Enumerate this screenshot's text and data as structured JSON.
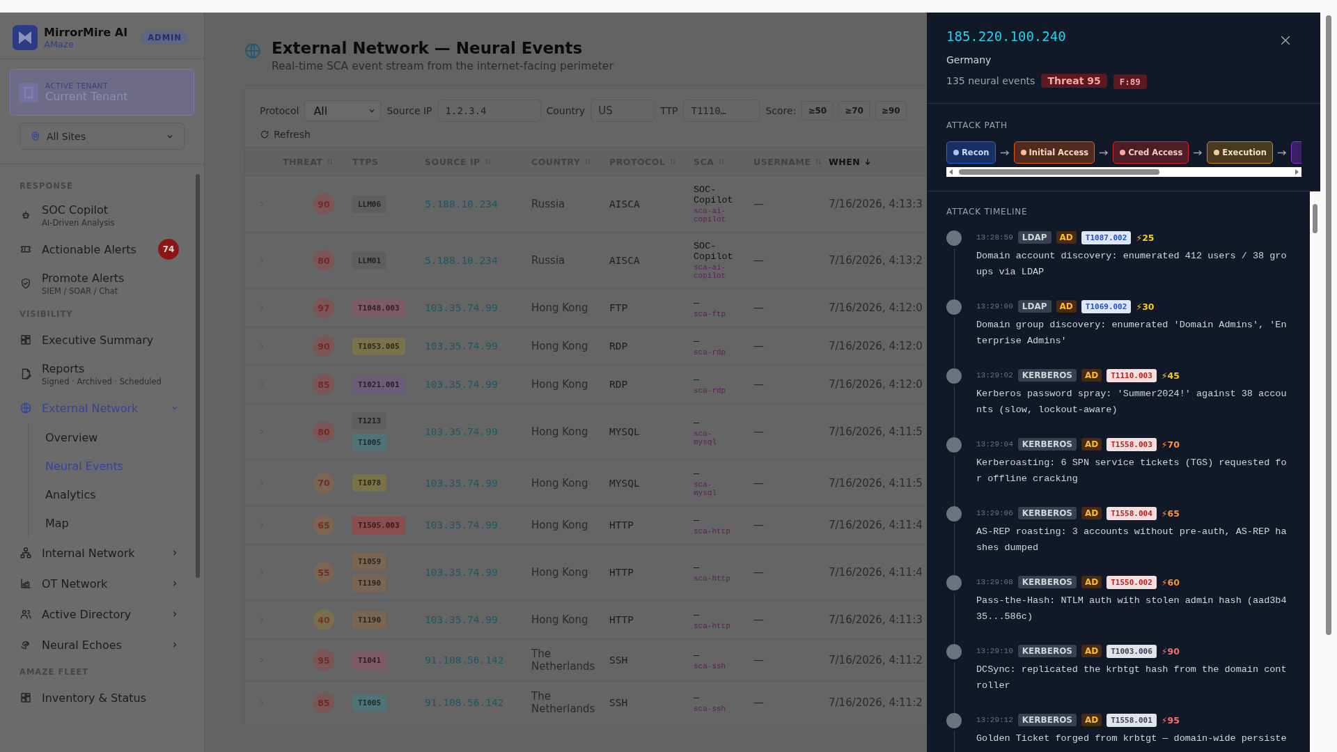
{
  "sidebar": {
    "brand": {
      "name": "MirrorMire AI",
      "org": "AMaze",
      "role": "ADMIN"
    },
    "tenant": {
      "label": "ACTIVE TENANT",
      "name": "Current Tenant"
    },
    "site_select": {
      "value": "All Sites"
    },
    "sections": [
      {
        "title": "RESPONSE",
        "items": [
          {
            "label": "SOC Copilot",
            "sublabel": "AI-Driven Analysis",
            "selected": false
          },
          {
            "label": "Actionable Alerts",
            "badge": "74",
            "selected": false
          },
          {
            "label": "Promote Alerts",
            "sublabel": "SIEM / SOAR / Chat",
            "selected": false
          }
        ]
      },
      {
        "title": "VISIBILITY",
        "items": [
          {
            "label": "Executive Summary",
            "selected": false
          },
          {
            "label": "Reports",
            "sublabel": "Signed · Archived · Scheduled",
            "selected": false
          },
          {
            "label": "External Network",
            "selected": true,
            "expanded": true,
            "children": [
              {
                "label": "Overview",
                "selected": false
              },
              {
                "label": "Neural Events",
                "selected": true
              },
              {
                "label": "Analytics",
                "selected": false
              },
              {
                "label": "Map",
                "selected": false
              }
            ]
          },
          {
            "label": "Internal Network",
            "selected": false,
            "expanded": false
          },
          {
            "label": "OT Network",
            "selected": false,
            "expanded": false
          },
          {
            "label": "Active Directory",
            "selected": false,
            "expanded": false
          },
          {
            "label": "Neural Echoes",
            "selected": false,
            "expanded": false
          }
        ]
      },
      {
        "title": "AMAZE FLEET",
        "items": [
          {
            "label": "Inventory & Status",
            "selected": false
          }
        ]
      }
    ]
  },
  "page": {
    "title": "External Network — Neural Events",
    "subtitle": "Real-time SCA event stream from the internet-facing perimeter"
  },
  "filters": {
    "protocol": {
      "label": "Protocol",
      "value": "All"
    },
    "source_ip": {
      "label": "Source IP",
      "placeholder": "1.2.3.4"
    },
    "country": {
      "label": "Country",
      "placeholder": "US"
    },
    "ttp": {
      "label": "TTP",
      "placeholder": "T1110…"
    },
    "score": {
      "label": "Score:",
      "options": [
        {
          "label": "≥50",
          "selected": false
        },
        {
          "label": "≥70",
          "selected": false
        },
        {
          "label": "≥90",
          "selected": false
        }
      ]
    },
    "refresh": "Refresh"
  },
  "table": {
    "columns": [
      {
        "label": "THREAT",
        "sortable": true,
        "sorted": false
      },
      {
        "label": "TTPS",
        "sortable": false,
        "sorted": false
      },
      {
        "label": "SOURCE IP",
        "sortable": true,
        "sorted": false
      },
      {
        "label": "COUNTRY",
        "sortable": true,
        "sorted": false
      },
      {
        "label": "PROTOCOL",
        "sortable": true,
        "sorted": false
      },
      {
        "label": "SCA",
        "sortable": true,
        "sorted": false
      },
      {
        "label": "USERNAME",
        "sortable": true,
        "sorted": false
      },
      {
        "label": "WHEN",
        "sorted": true
      }
    ],
    "rows": [
      {
        "expanded": false,
        "threat": {
          "score": "90",
          "color": "#7c5656"
        },
        "ttps": [
          {
            "label": "LLM06",
            "color": "#5e5e5e"
          }
        ],
        "source_ip": "5.188.10.234",
        "country": "Russia",
        "protocol": "AISCA",
        "sca": {
          "name": "SOC-Copilot",
          "id": "sca-ai-copilot"
        },
        "username": "—",
        "when": "7/16/2026, 4:13:3"
      },
      {
        "expanded": false,
        "threat": {
          "score": "80",
          "color": "#7c5656"
        },
        "ttps": [
          {
            "label": "LLM01",
            "color": "#5e5e5e"
          }
        ],
        "source_ip": "5.188.10.234",
        "country": "Russia",
        "protocol": "AISCA",
        "sca": {
          "name": "SOC-Copilot",
          "id": "sca-ai-copilot"
        },
        "username": "—",
        "when": "7/16/2026, 4:13:2"
      },
      {
        "expanded": false,
        "threat": {
          "score": "97",
          "color": "#7c5656"
        },
        "ttps": [
          {
            "label": "T1048.003",
            "color": "#7d5a66"
          }
        ],
        "source_ip": "103.35.74.99",
        "country": "Hong Kong",
        "protocol": "FTP",
        "sca": {
          "name": "—",
          "id": "sca-ftp"
        },
        "username": "—",
        "when": "7/16/2026, 4:12:0"
      },
      {
        "expanded": false,
        "threat": {
          "score": "90",
          "color": "#7c5656"
        },
        "ttps": [
          {
            "label": "T1053.005",
            "color": "#7a7248"
          }
        ],
        "source_ip": "103.35.74.99",
        "country": "Hong Kong",
        "protocol": "RDP",
        "sca": {
          "name": "—",
          "id": "sca-rdp"
        },
        "username": "—",
        "when": "7/16/2026, 4:12:0"
      },
      {
        "expanded": false,
        "threat": {
          "score": "85",
          "color": "#7c5656"
        },
        "ttps": [
          {
            "label": "T1021.001",
            "color": "#6c5c78"
          }
        ],
        "source_ip": "103.35.74.99",
        "country": "Hong Kong",
        "protocol": "RDP",
        "sca": {
          "name": "—",
          "id": "sca-rdp"
        },
        "username": "—",
        "when": "7/16/2026, 4:12:0"
      },
      {
        "expanded": false,
        "threat": {
          "score": "80",
          "color": "#7c5656"
        },
        "ttps": [
          {
            "label": "T1213",
            "color": "#5e5e5e"
          },
          {
            "label": "T1005",
            "color": "#4f7478"
          }
        ],
        "source_ip": "103.35.74.99",
        "country": "Hong Kong",
        "protocol": "MYSQL",
        "sca": {
          "name": "—",
          "id": "sca-mysql"
        },
        "username": "—",
        "when": "7/16/2026, 4:11:5"
      },
      {
        "expanded": false,
        "threat": {
          "score": "70",
          "color": "#7a6652"
        },
        "ttps": [
          {
            "label": "T1078",
            "color": "#7a7248"
          }
        ],
        "source_ip": "103.35.74.99",
        "country": "Hong Kong",
        "protocol": "MYSQL",
        "sca": {
          "name": "—",
          "id": "sca-mysql"
        },
        "username": "—",
        "when": "7/16/2026, 4:11:5"
      },
      {
        "expanded": false,
        "threat": {
          "score": "65",
          "color": "#7a6652"
        },
        "ttps": [
          {
            "label": "T1505.003",
            "color": "#8a4e4e"
          }
        ],
        "source_ip": "103.35.74.99",
        "country": "Hong Kong",
        "protocol": "HTTP",
        "sca": {
          "name": "—",
          "id": "sca-http"
        },
        "username": "—",
        "when": "7/16/2026, 4:11:4"
      },
      {
        "expanded": false,
        "threat": {
          "score": "55",
          "color": "#7a6652"
        },
        "ttps": [
          {
            "label": "T1059",
            "color": "#7a6652"
          },
          {
            "label": "T1190",
            "color": "#7a6652"
          }
        ],
        "source_ip": "103.35.74.99",
        "country": "Hong Kong",
        "protocol": "HTTP",
        "sca": {
          "name": "—",
          "id": "sca-http"
        },
        "username": "—",
        "when": "7/16/2026, 4:11:4"
      },
      {
        "expanded": false,
        "threat": {
          "score": "40",
          "color": "#76704c"
        },
        "ttps": [
          {
            "label": "T1190",
            "color": "#7a6652"
          }
        ],
        "source_ip": "103.35.74.99",
        "country": "Hong Kong",
        "protocol": "HTTP",
        "sca": {
          "name": "—",
          "id": "sca-http"
        },
        "username": "—",
        "when": "7/16/2026, 4:11:3"
      },
      {
        "expanded": false,
        "threat": {
          "score": "95",
          "color": "#7c5656"
        },
        "ttps": [
          {
            "label": "T1041",
            "color": "#7d5a66"
          }
        ],
        "source_ip": "91.108.56.142",
        "country": "The Netherlands",
        "protocol": "SSH",
        "sca": {
          "name": "—",
          "id": "sca-ssh"
        },
        "username": "—",
        "when": "7/16/2026, 4:11:2"
      },
      {
        "expanded": false,
        "threat": {
          "score": "85",
          "color": "#7c5656"
        },
        "ttps": [
          {
            "label": "T1005",
            "color": "#4f7478"
          }
        ],
        "source_ip": "91.108.56.142",
        "country": "The Netherlands",
        "protocol": "SSH",
        "sca": {
          "name": "—",
          "id": "sca-ssh"
        },
        "username": "—",
        "when": "7/16/2026, 4:11:2"
      }
    ]
  },
  "drawer": {
    "ip": "185.220.100.240",
    "country": "Germany",
    "events": "135 neural events",
    "threat": "Threat 95",
    "flag": "F:89",
    "attack_path": {
      "title": "ATTACK PATH",
      "stages": [
        {
          "label": "Recon",
          "color": "#2563eb"
        },
        {
          "label": "Initial Access",
          "color": "#ea580c"
        },
        {
          "label": "Cred Access",
          "color": "#dc2626"
        },
        {
          "label": "Execution",
          "color": "#ca8a04"
        },
        {
          "color": "#9333ea"
        }
      ]
    },
    "timeline": {
      "title": "ATTACK TIMELINE",
      "events": [
        {
          "time": "13:28:59",
          "protocol": "LDAP",
          "category": "AD",
          "technique": {
            "label": "T1087.002",
            "color": "#1d4ed8"
          },
          "score": {
            "label": "⚡25",
            "color": "#facc15"
          },
          "text": "Domain account discovery: enumerated 412 users / 38 groups via LDAP"
        },
        {
          "time": "13:29:00",
          "protocol": "LDAP",
          "category": "AD",
          "technique": {
            "label": "T1069.002",
            "color": "#1d4ed8"
          },
          "score": {
            "label": "⚡30",
            "color": "#facc15"
          },
          "text": "Domain group discovery: enumerated 'Domain Admins', 'Enterprise Admins'"
        },
        {
          "time": "13:29:02",
          "protocol": "KERBEROS",
          "category": "AD",
          "technique": {
            "label": "T1110.003",
            "color": "#b91c1c"
          },
          "score": {
            "label": "⚡45",
            "color": "#facc15"
          },
          "text": "Kerberos password spray: 'Summer2024!' against 38 accounts (slow, lockout-aware)"
        },
        {
          "time": "13:29:04",
          "protocol": "KERBEROS",
          "category": "AD",
          "technique": {
            "label": "T1558.003",
            "color": "#b91c1c"
          },
          "score": {
            "label": "⚡70",
            "color": "#fb923c"
          },
          "text": "Kerberoasting: 6 SPN service tickets (TGS) requested for offline cracking"
        },
        {
          "time": "13:29:06",
          "protocol": "KERBEROS",
          "category": "AD",
          "technique": {
            "label": "T1558.004",
            "color": "#b91c1c"
          },
          "score": {
            "label": "⚡65",
            "color": "#fb923c"
          },
          "text": "AS-REP roasting: 3 accounts without pre-auth, AS-REP hashes dumped"
        },
        {
          "time": "13:29:08",
          "protocol": "KERBEROS",
          "category": "AD",
          "technique": {
            "label": "T1550.002",
            "color": "#b91c1c"
          },
          "score": {
            "label": "⚡60",
            "color": "#fb923c"
          },
          "text": "Pass-the-Hash: NTLM auth with stolen admin hash (aad3b435...586c)"
        },
        {
          "time": "13:29:10",
          "protocol": "KERBEROS",
          "category": "AD",
          "technique": {
            "label": "T1003.006",
            "color": "#374151"
          },
          "score": {
            "label": "⚡90",
            "color": "#f87171"
          },
          "text": "DCSync: replicated the krbtgt hash from the domain controller"
        },
        {
          "time": "13:29:12",
          "protocol": "KERBEROS",
          "category": "AD",
          "technique": {
            "label": "T1558.001",
            "color": "#374151"
          },
          "score": {
            "label": "⚡95",
            "color": "#f87171"
          },
          "text": "Golden Ticket forged from krbtgt — domain-wide persiste"
        }
      ]
    }
  }
}
